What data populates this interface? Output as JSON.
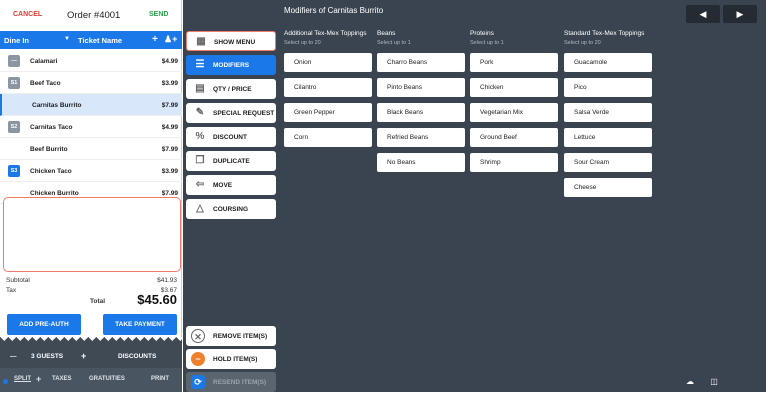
{
  "header": {
    "cancel": "CANCEL",
    "order_title": "Order #4001",
    "send": "SEND"
  },
  "order_bar": {
    "dine_in": "Dine In",
    "dropdown_icon": "▼",
    "ticket_name": "Ticket Name",
    "plus": "+",
    "add_guest_icon": "person-plus-icon"
  },
  "items": [
    {
      "seat": "—",
      "name": "Calamari",
      "price": "$4.99",
      "selected": false
    },
    {
      "seat": "S1",
      "name": "Beef Taco",
      "price": "$3.99",
      "selected": false
    },
    {
      "seat": "",
      "name": "Carnitas Burrito",
      "price": "$7.99",
      "selected": true
    },
    {
      "seat": "S2",
      "name": "Carnitas Taco",
      "price": "$4.99",
      "selected": false
    },
    {
      "seat": "",
      "name": "Beef Burrito",
      "price": "$7.99",
      "selected": false
    },
    {
      "seat": "S3",
      "name": "Chicken Taco",
      "price": "$3.99",
      "selected": false
    },
    {
      "seat": "",
      "name": "Chicken Burrito",
      "price": "$7.99",
      "selected": false
    }
  ],
  "totals": {
    "subtotal_label": "Subtotal",
    "subtotal": "$41.93",
    "tax_label": "Tax",
    "tax": "$3.67",
    "total_label": "Total",
    "total": "$45.60"
  },
  "payment": {
    "pre_auth": "ADD PRE-AUTH",
    "take_payment": "TAKE PAYMENT"
  },
  "guests": {
    "minus": "—",
    "count": "3 GUESTS",
    "plus": "+",
    "discounts": "DISCOUNTS"
  },
  "bottom": {
    "split": "SPLIT",
    "split_plus": "+",
    "taxes": "TAXES",
    "gratuities": "GRATUITIES",
    "print": "PRINT"
  },
  "actions": {
    "show_menu": "SHOW MENU",
    "modifiers": "MODIFIERS",
    "qty_price": "QTY / PRICE",
    "special_request": "SPECIAL REQUEST",
    "discount": "DISCOUNT",
    "duplicate": "DUPLICATE",
    "move": "MOVE",
    "coursing": "COURSING",
    "remove": "REMOVE ITEM(S)",
    "hold": "HOLD ITEM(S)",
    "resend": "RESEND ITEM(S)"
  },
  "modifiers": {
    "title": "Modifiers of Carnitas Burrito",
    "nav_prev": "◀",
    "nav_next": "▶",
    "columns": [
      {
        "head": "Additional Tex-Mex Toppings",
        "sub": "Select up to 20",
        "items": [
          "Onion",
          "Cilantro",
          "Green Pepper",
          "Corn"
        ]
      },
      {
        "head": "Beans",
        "sub": "Select up to 1",
        "items": [
          "Charro Beans",
          "Pinto Beans",
          "Black Beans",
          "Refried Beans",
          "No Beans"
        ]
      },
      {
        "head": "Proteins",
        "sub": "Select up to 1",
        "items": [
          "Pork",
          "Chicken",
          "Vegetarian Mix",
          "Ground Beef",
          "Shrimp"
        ]
      },
      {
        "head": "Standard Tex-Mex Toppings",
        "sub": "Select up to 20",
        "items": [
          "Guacamole",
          "Pico",
          "Salsa Verde",
          "Lettuce",
          "Sour Cream",
          "Cheese"
        ]
      }
    ]
  },
  "colors": {
    "accent": "#1b78e8",
    "danger": "#e23a2f",
    "success": "#28a34a",
    "panel": "#3a4450",
    "highlight_border": "#f07a6b"
  }
}
